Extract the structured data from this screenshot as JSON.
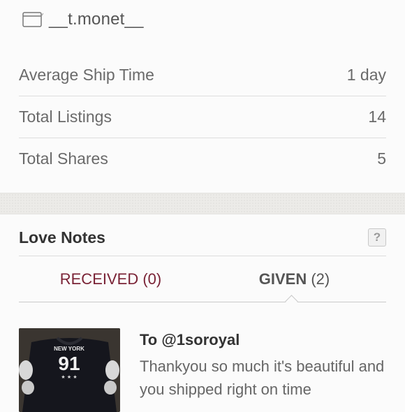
{
  "header": {
    "username": "__t.monet__",
    "icon": "browser-icon"
  },
  "stats": [
    {
      "label": "Average Ship Time",
      "value": "1 day"
    },
    {
      "label": "Total Listings",
      "value": "14"
    },
    {
      "label": "Total Shares",
      "value": "5"
    }
  ],
  "love_notes": {
    "title": "Love Notes",
    "help_label": "?",
    "tabs": [
      {
        "label": "RECEIVED",
        "count": "(0)"
      },
      {
        "label": "GIVEN",
        "count": "(2)"
      }
    ],
    "notes": [
      {
        "to": "To @1soroyal",
        "text": "Thankyou so much it's beautiful and you shipped right on time",
        "thumb": {
          "shirt_text": "NEW YORK",
          "number": "91"
        }
      }
    ]
  },
  "colors": {
    "received_tab": "#7a2336",
    "band": "#ecebe8"
  }
}
